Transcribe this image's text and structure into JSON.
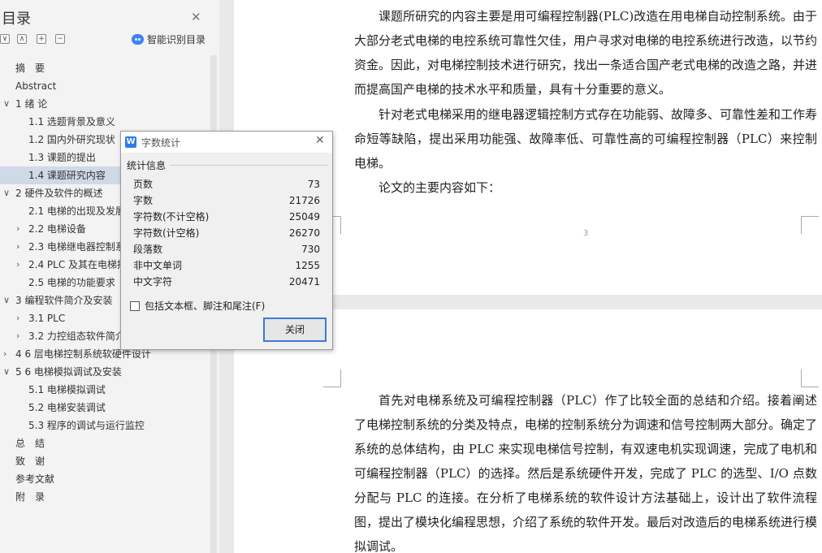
{
  "sidebar": {
    "title": "目录",
    "ai_label": "智能识别目录",
    "items": [
      {
        "text": "摘　要"
      },
      {
        "text": "Abstract"
      },
      {
        "text": "1 绪  论",
        "arrow": "∨"
      },
      {
        "text": "1.1 选题背景及意义"
      },
      {
        "text": "1.2 国内外研究现状"
      },
      {
        "text": "1.3 课题的提出"
      },
      {
        "text": "1.4 课题研究内容",
        "selected": true
      },
      {
        "text": "2 硬件及软件的概述",
        "arrow": "∨"
      },
      {
        "text": "2.1  电梯的出现及发展"
      },
      {
        "text": "2.2  电梯设备",
        "arrow": "›"
      },
      {
        "text": "2.3 电梯继电器控制系",
        "arrow": "›"
      },
      {
        "text": "2.4 PLC 及其在电梯控",
        "arrow": "›"
      },
      {
        "text": "2.5 电梯的功能要求"
      },
      {
        "text": "3 编程软件简介及安装",
        "arrow": "∨"
      },
      {
        "text": "3.1 PLC",
        "arrow": "›"
      },
      {
        "text": "3.2 力控组态软件简介",
        "arrow": "›"
      },
      {
        "text": "4 6 层电梯控制系统软硬件设计",
        "arrow": "›"
      },
      {
        "text": "5 6 电梯模拟调试及安装",
        "arrow": "∨"
      },
      {
        "text": "5.1  电梯模拟调试"
      },
      {
        "text": "5.2  电梯安装调试"
      },
      {
        "text": "5.3  程序的调试与运行监控"
      },
      {
        "text": "总　结"
      },
      {
        "text": "致　谢"
      },
      {
        "text": "参考文献"
      },
      {
        "text": "附　录"
      }
    ]
  },
  "document": {
    "page1_paragraphs": [
      "课题所研究的内容主要是用可编程控制器(PLC)改造在用电梯自动控制系统。由于大部分老式电梯的电控系统可靠性欠佳，用户寻求对电梯的电控系统进行改造，以节约资金。因此，对电梯控制技术进行研究，找出一条适合国产老式电梯的改造之路，并进而提高国产电梯的技术水平和质量，具有十分重要的意义。",
      "针对老式电梯采用的继电器逻辑控制方式存在功能弱、故障多、可靠性差和工作寿命短等缺陷，提出采用功能强、故障率低、可靠性高的可编程控制器（PLC）来控制电梯。",
      "论文的主要内容如下："
    ],
    "page_number": "3",
    "page2_paragraphs": [
      "首先对电梯系统及可编程控制器（PLC）作了比较全面的总结和介绍。接着阐述了电梯控制系统的分类及特点，电梯的控制系统分为调速和信号控制两大部分。确定了系统的总体结构，由 PLC 来实现电梯信号控制，有双速电机实现调速，完成了电机和可编程控制器（PLC）的选择。然后是系统硬件开发，完成了 PLC 的选型、I/O 点数分配与 PLC 的连接。在分析了电梯系统的软件设计方法基础上，设计出了软件流程图，提出了模块化编程思想，介绍了系统的软件开发。最后对改造后的电梯系统进行模拟调试。"
    ]
  },
  "dialog": {
    "title": "字数统计",
    "section": "统计信息",
    "stats": [
      {
        "label": "页数",
        "value": "73"
      },
      {
        "label": "字数",
        "value": "21726"
      },
      {
        "label": "字符数(不计空格)",
        "value": "25049"
      },
      {
        "label": "字符数(计空格)",
        "value": "26270"
      },
      {
        "label": "段落数",
        "value": "730"
      },
      {
        "label": "非中文单词",
        "value": "1255"
      },
      {
        "label": "中文字符",
        "value": "20471"
      }
    ],
    "checkbox_label": "包括文本框、脚注和尾注(F)",
    "close_button": "关闭"
  },
  "icons": {
    "collapse": "collapse-all-icon",
    "expand": "expand-level-icon",
    "add": "add-heading-icon",
    "remove": "remove-heading-icon",
    "ai": "ai-assistant-icon",
    "app": "wps-writer-icon"
  },
  "colors": {
    "selection": "#cfd9e8",
    "button_border": "#3a7bd5",
    "app_logo": "#2b7de9"
  }
}
